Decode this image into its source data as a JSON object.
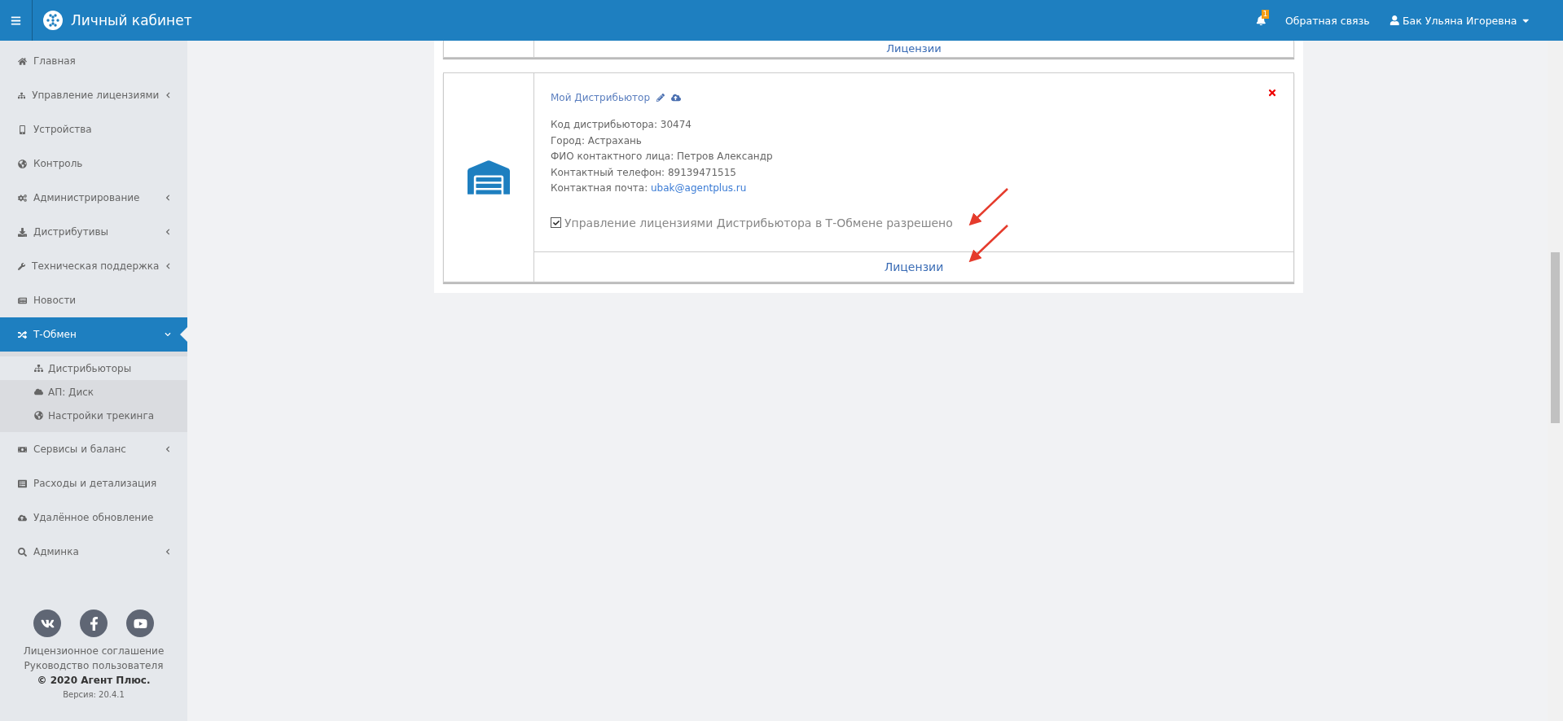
{
  "header": {
    "title": "Личный кабинет",
    "notification_count": "1",
    "feedback": "Обратная связь",
    "user": "Бак Ульяна Игоревна"
  },
  "sidebar": {
    "items": [
      {
        "label": "Главная",
        "kind": "link",
        "selected": false
      },
      {
        "label": "Управление лицензиями",
        "kind": "group",
        "expanded": false,
        "selected": false
      },
      {
        "label": "Устройства",
        "kind": "link",
        "selected": false
      },
      {
        "label": "Контроль",
        "kind": "link",
        "selected": false
      },
      {
        "label": "Администрирование",
        "kind": "group",
        "expanded": false,
        "selected": false
      },
      {
        "label": "Дистрибутивы",
        "kind": "group",
        "expanded": false,
        "selected": false
      },
      {
        "label": "Техническая поддержка",
        "kind": "group",
        "expanded": false,
        "selected": false
      },
      {
        "label": "Новости",
        "kind": "link",
        "selected": false
      },
      {
        "label": "Т-Обмен",
        "kind": "group",
        "expanded": true,
        "selected": true,
        "children": [
          {
            "label": "Дистрибьюторы",
            "selected": true
          },
          {
            "label": "АП: Диск",
            "selected": false
          },
          {
            "label": "Настройки трекинга",
            "selected": false
          }
        ]
      },
      {
        "label": "Сервисы и баланс",
        "kind": "group",
        "expanded": false,
        "selected": false
      },
      {
        "label": "Расходы и детализация",
        "kind": "link",
        "selected": false
      },
      {
        "label": "Удалённое обновление",
        "kind": "link",
        "selected": false
      },
      {
        "label": "Админка",
        "kind": "group",
        "expanded": false,
        "selected": false
      }
    ],
    "footer": {
      "links": [
        "Лицензионное соглашение",
        "Руководство пользователя"
      ],
      "copyright": "© 2020 Агент Плюс.",
      "version": "Версия: 20.4.1"
    }
  },
  "previous_card": {
    "link": "Лицензии"
  },
  "card": {
    "name": "Мой Дистрибьютор",
    "fields": [
      {
        "label": "Код дистрибьютора:",
        "value": "30474",
        "kind": "text"
      },
      {
        "label": "Город:",
        "value": "Астрахань",
        "kind": "text"
      },
      {
        "label": "ФИО контактного лица:",
        "value": "Петров Александр",
        "kind": "text"
      },
      {
        "label": "Контактный телефон:",
        "value": "89139471515",
        "kind": "text"
      },
      {
        "label": "Контактная почта:",
        "value": "ubak@agentplus.ru",
        "kind": "link"
      }
    ],
    "permission": {
      "label": "Управление лицензиями Дистрибьютора в Т-Обмене разрешено",
      "checked": true
    },
    "link": "Лицензии"
  }
}
